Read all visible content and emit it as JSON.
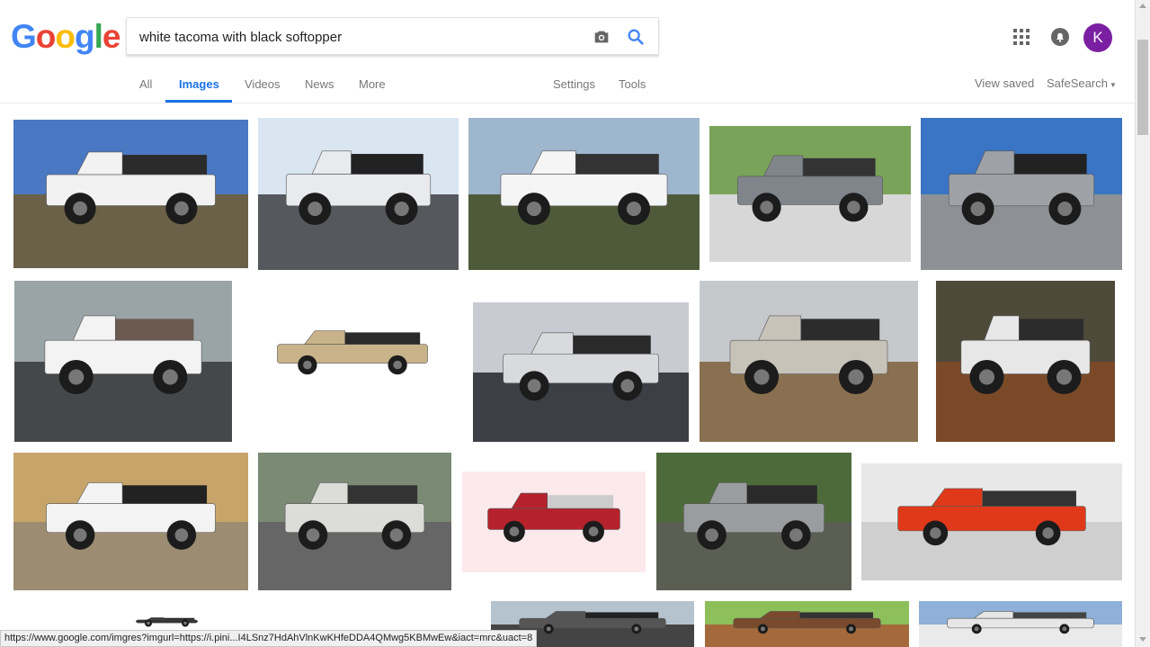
{
  "search": {
    "query": "white tacoma with black softopper"
  },
  "logo_letters": [
    {
      "ch": "G",
      "color": "#4285F4"
    },
    {
      "ch": "o",
      "color": "#EA4335"
    },
    {
      "ch": "o",
      "color": "#FBBC05"
    },
    {
      "ch": "g",
      "color": "#4285F4"
    },
    {
      "ch": "l",
      "color": "#34A853"
    },
    {
      "ch": "e",
      "color": "#EA4335"
    }
  ],
  "nav": {
    "all": "All",
    "images": "Images",
    "videos": "Videos",
    "news": "News",
    "more": "More",
    "settings": "Settings",
    "tools": "Tools",
    "view_saved": "View saved",
    "safesearch": "SafeSearch"
  },
  "account": {
    "initial": "K",
    "color": "#7B1FA2"
  },
  "accent_color": "#1A73E8",
  "status_url": "https://www.google.com/imgres?imgurl=https://i.pini...I4LSnz7HdAhVlnKwKHfeDDA4QMwg5KBMwEw&iact=mrc&uact=8",
  "results": [
    {
      "truck": "#f2f2f2",
      "topper": "#2b2b2b",
      "sky": "#4a78c2",
      "ground": "#6b6048"
    },
    {
      "truck": "#e8eaee",
      "topper": "#222",
      "sky": "#d9e6f2",
      "ground": "#55585c"
    },
    {
      "truck": "#f5f5f5",
      "topper": "#333",
      "sky": "#9fb6cf",
      "ground": "#4f5a3a"
    },
    {
      "truck": "#80858c",
      "topper": "#333",
      "sky": "#7aa35a",
      "ground": "#d7d7d7"
    },
    {
      "truck": "#9ea2a6",
      "topper": "#222",
      "sky": "#3a74c4",
      "ground": "#8d9196"
    },
    {
      "truck": "#f3f3f3",
      "topper": "#6a5a50",
      "sky": "#9aa3a5",
      "ground": "#45484a"
    },
    {
      "truck": "#c9b38a",
      "topper": "#2a2a2a",
      "sky": "#ffffff",
      "ground": "#ffffff"
    },
    {
      "truck": "#d8dadd",
      "topper": "#2a2a2a",
      "sky": "#c8ccd2",
      "ground": "#3c4046"
    },
    {
      "truck": "#c7c3b8",
      "topper": "#2c2c2c",
      "sky": "#c6c9cc",
      "ground": "#8a7050"
    },
    {
      "truck": "#e7e7e7",
      "topper": "#2c2c2c",
      "sky": "#4e4a3a",
      "ground": "#7a4a28"
    },
    {
      "truck": "#f3f3f3",
      "topper": "#222",
      "sky": "#c7a56a",
      "ground": "#9c8c72"
    },
    {
      "truck": "#dcdcd8",
      "topper": "#333",
      "sky": "#7b8a74",
      "ground": "#666"
    },
    {
      "truck": "#b5222c",
      "topper": "#ccc",
      "sky": "#fbe9ec",
      "ground": "#fbe9ec"
    },
    {
      "truck": "#9a9da0",
      "topper": "#2a2a2a",
      "sky": "#4d6b3a",
      "ground": "#5b5e52"
    },
    {
      "truck": "#e0391a",
      "topper": "#333",
      "sky": "#e8e8e8",
      "ground": "#cfcfcf"
    },
    {
      "truck": "#333",
      "topper": "#222",
      "sky": "#ffffff",
      "ground": "#ffffff"
    },
    {
      "truck": "#555",
      "topper": "#222",
      "sky": "#b5c3cf",
      "ground": "#444"
    },
    {
      "truck": "#7a4a2c",
      "topper": "#333",
      "sky": "#8dbf5a",
      "ground": "#a46a3c"
    },
    {
      "truck": "#e6e6e6",
      "topper": "#444",
      "sky": "#8fb0d8",
      "ground": "#eaeaea"
    }
  ]
}
